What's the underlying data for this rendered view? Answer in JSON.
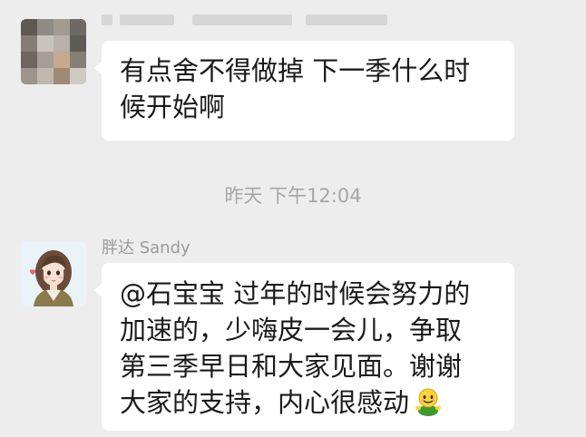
{
  "messages": [
    {
      "sender": "",
      "lines": [
        "有点舍不得做掉 下一季什么时",
        "候开始啊"
      ]
    },
    {
      "sender": "胖达 Sandy",
      "lines": [
        "@石宝宝 过年的时候会努力的",
        "加速的，少嗨皮一会儿，争取",
        "第三季早日和大家见面。谢谢",
        "大家的支持，内心很感动"
      ],
      "emoji": "green-smiley-emoji"
    }
  ],
  "timestamp": "昨天 下午12:04",
  "colors": {
    "background": "#ededed",
    "bubble": "#ffffff",
    "meta_text": "#9a9a9a"
  }
}
